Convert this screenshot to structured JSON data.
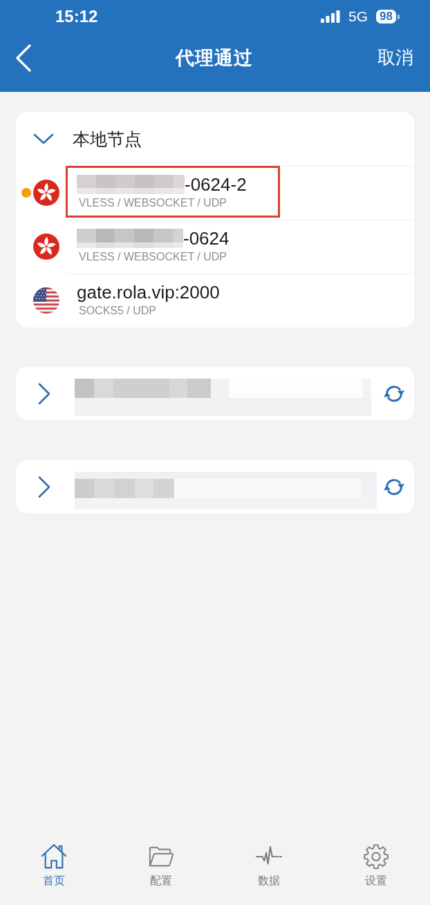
{
  "status_bar": {
    "time": "15:12",
    "network": "5G",
    "battery": "98"
  },
  "nav_bar": {
    "title": "代理通过",
    "action": "取消"
  },
  "node_groups": [
    {
      "title": "本地节点",
      "expanded": true,
      "nodes": [
        {
          "name": "-0624-2",
          "redacted": true,
          "protocol": "VLESS / WEBSOCKET / UDP",
          "kind": "hk",
          "selected": true,
          "highlighted": true
        },
        {
          "name": "-0624",
          "redacted": true,
          "protocol": "VLESS / WEBSOCKET / UDP",
          "kind": "hk",
          "selected": false,
          "highlighted": false
        },
        {
          "name": "gate.rola.vip:2000",
          "redacted": false,
          "protocol": "SOCKS5 / UDP",
          "kind": "us",
          "selected": false,
          "highlighted": false
        }
      ]
    }
  ],
  "subscription_groups": [
    {
      "expanded": false,
      "redacted": true
    },
    {
      "expanded": false,
      "redacted": true
    }
  ],
  "tab_bar": [
    {
      "label": "首页",
      "kind": "home",
      "selected": true
    },
    {
      "label": "配置",
      "kind": "folder",
      "selected": false
    },
    {
      "label": "数据",
      "kind": "pulse",
      "selected": false
    },
    {
      "label": "设置",
      "kind": "gear",
      "selected": false
    }
  ]
}
